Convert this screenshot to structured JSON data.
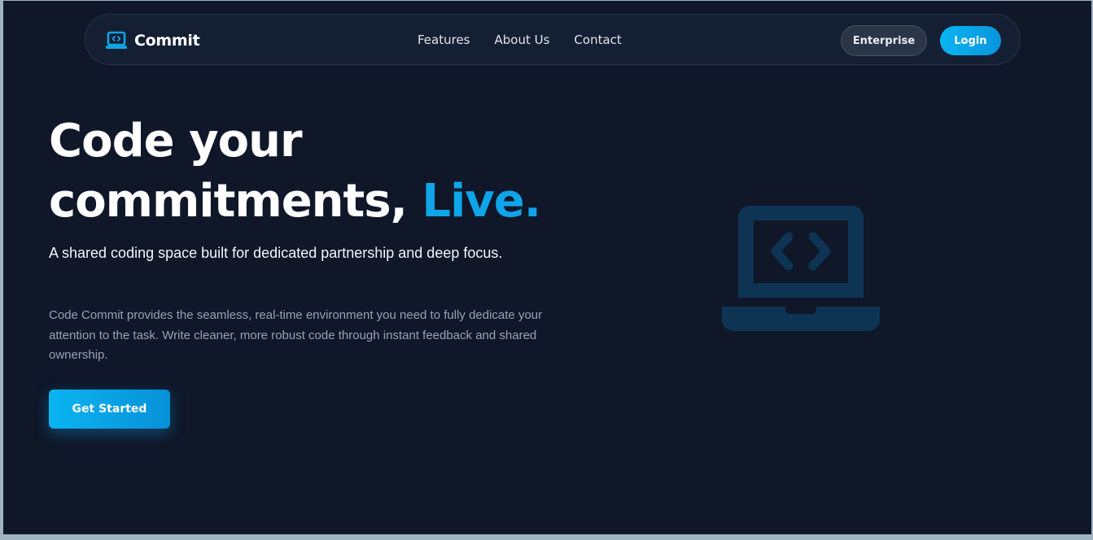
{
  "nav": {
    "brand": "Commit",
    "brand_icon": "laptop-code-icon",
    "links": [
      "Features",
      "About Us",
      "Contact"
    ],
    "enterprise_label": "Enterprise",
    "login_label": "Login"
  },
  "hero": {
    "title_part1": "Code your",
    "title_part2": "commitments, ",
    "title_accent": "Live.",
    "subtitle": "A shared coding space built for dedicated partnership and deep focus.",
    "description": "Code Commit provides the seamless, real-time environment you need to fully dedicate your attention to the task. Write cleaner, more robust code through instant feedback and shared ownership.",
    "cta_label": "Get Started",
    "illustration_icon": "laptop-code-icon"
  },
  "colors": {
    "background": "#0f1729",
    "accent": "#0ea5e9",
    "nav_background": "#151f33",
    "illustration": "#0e3454"
  }
}
